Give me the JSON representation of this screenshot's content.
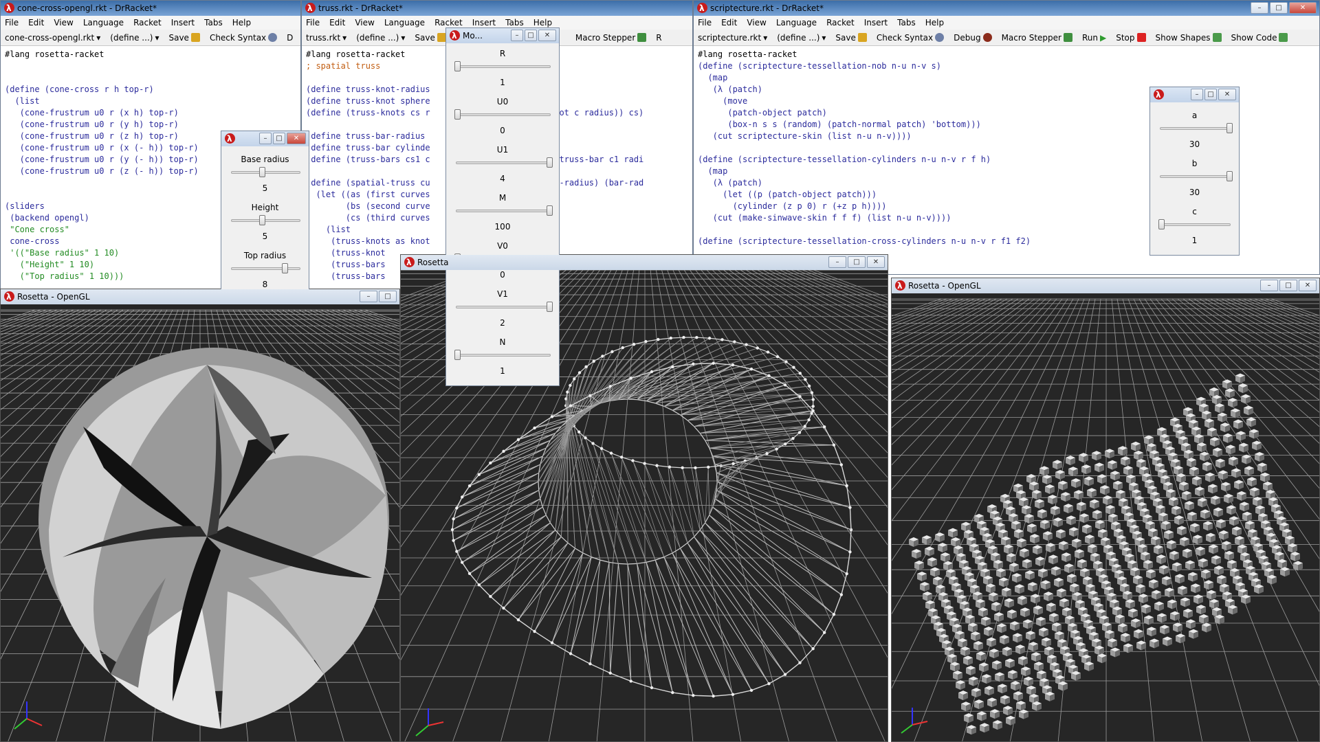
{
  "colors": {
    "accent": "#c91b1b",
    "code_blue": "#2b2b9c",
    "string_green": "#228b22",
    "comment_orange": "#c25e12",
    "gl_bg": "#262626"
  },
  "win_left": {
    "title": "cone-cross-opengl.rkt - DrRacket*",
    "menu": [
      "File",
      "Edit",
      "View",
      "Language",
      "Racket",
      "Insert",
      "Tabs",
      "Help"
    ],
    "toolbar": {
      "file": "cone-cross-opengl.rkt",
      "define": "(define ...)",
      "save": "Save",
      "check": "Check Syntax",
      "debug": "D"
    },
    "code": [
      "#lang rosetta-racket",
      "",
      "",
      "(define (cone-cross r h top-r)",
      "  (list",
      "   (cone-frustrum u0 r (x h) top-r)",
      "   (cone-frustrum u0 r (y h) top-r)",
      "   (cone-frustrum u0 r (z h) top-r)",
      "   (cone-frustrum u0 r (x (- h)) top-r)",
      "   (cone-frustrum u0 r (y (- h)) top-r)",
      "   (cone-frustrum u0 r (z (- h)) top-r)",
      "",
      "",
      "(sliders",
      " (backend opengl)",
      " \"Cone cross\"",
      " cone-cross",
      " '((\"Base radius\" 1 10)",
      "   (\"Height\" 1 10)",
      "   (\"Top radius\" 1 10)))"
    ]
  },
  "win_mid": {
    "title": "truss.rkt - DrRacket*",
    "menu": [
      "File",
      "Edit",
      "View",
      "Language",
      "Racket",
      "Insert",
      "Tabs",
      "Help"
    ],
    "toolbar": {
      "file": "truss.rkt",
      "define": "(define ...)",
      "save": "Save",
      "macro": "Macro Stepper",
      "run": "R"
    },
    "code": [
      "#lang rosetta-racket",
      "; spatial truss",
      "",
      "(define truss-knot-radius",
      "(define truss-knot sphere",
      "(define (truss-knots cs r                   russ-knot c radius)) cs)",
      "",
      "(define truss-bar-radius",
      "(define truss-bar cylinde",
      "(define (truss-bars cs1 c                   l c2) (truss-bar c1 radi",
      "",
      "(define (spatial-truss cu                   ss-knot-radius) (bar-rad",
      "  (let ((as (first curves",
      "        (bs (second curve",
      "        (cs (third curves",
      "    (list",
      "     (truss-knots as knot",
      "     (truss-knot",
      "     (truss-bars",
      "     (truss-bars"
    ]
  },
  "win_right": {
    "title": "scriptecture.rkt - DrRacket*",
    "menu": [
      "File",
      "Edit",
      "View",
      "Language",
      "Racket",
      "Insert",
      "Tabs",
      "Help"
    ],
    "toolbar": {
      "file": "scriptecture.rkt",
      "define": "(define ...)",
      "save": "Save",
      "check": "Check Syntax",
      "debug": "Debug",
      "macro": "Macro Stepper",
      "run": "Run",
      "stop": "Stop",
      "shapes": "Show Shapes",
      "code": "Show Code"
    },
    "code": [
      "#lang rosetta-racket",
      "(define (scriptecture-tessellation-nob n-u n-v s)",
      "  (map",
      "   (λ (patch)",
      "     (move",
      "      (patch-object patch)",
      "      (box-n s s (random) (patch-normal patch) 'bottom)))",
      "   (cut scriptecture-skin (list n-u n-v))))",
      "",
      "(define (scriptecture-tessellation-cylinders n-u n-v r f h)",
      "  (map",
      "   (λ (patch)",
      "     (let ((p (patch-object patch)))",
      "       (cylinder (z p 0) r (+z p h))))",
      "   (cut (make-sinwave-skin f f f) (list n-u n-v))))",
      "",
      "(define (scriptecture-tessellation-cross-cylinders n-u n-v r f1 f2)"
    ]
  },
  "slider_cone": {
    "items": [
      {
        "label": "Base radius",
        "value": "5",
        "pos": 0.44
      },
      {
        "label": "Height",
        "value": "5",
        "pos": 0.44
      },
      {
        "label": "Top radius",
        "value": "8",
        "pos": 0.78
      }
    ]
  },
  "slider_truss": {
    "title": "Mo...",
    "items": [
      {
        "label": "R",
        "value": "1",
        "pos": 0.0
      },
      {
        "label": "U0",
        "value": "0",
        "pos": 0.0
      },
      {
        "label": "U1",
        "value": "4",
        "pos": 1.0
      },
      {
        "label": "M",
        "value": "100",
        "pos": 1.0
      },
      {
        "label": "V0",
        "value": "0",
        "pos": 0.0
      },
      {
        "label": "V1",
        "value": "2",
        "pos": 1.0
      },
      {
        "label": "N",
        "value": "1",
        "pos": 0.0
      }
    ]
  },
  "slider_scrip": {
    "items": [
      {
        "label": "a",
        "value": "30",
        "pos": 1.0
      },
      {
        "label": "b",
        "value": "30",
        "pos": 1.0
      },
      {
        "label": "c",
        "value": "1",
        "pos": 0.0
      }
    ]
  },
  "gl_left": {
    "title": "Rosetta - OpenGL"
  },
  "gl_mid": {
    "title": "Rosetta"
  },
  "gl_right": {
    "title": "Rosetta - OpenGL"
  }
}
